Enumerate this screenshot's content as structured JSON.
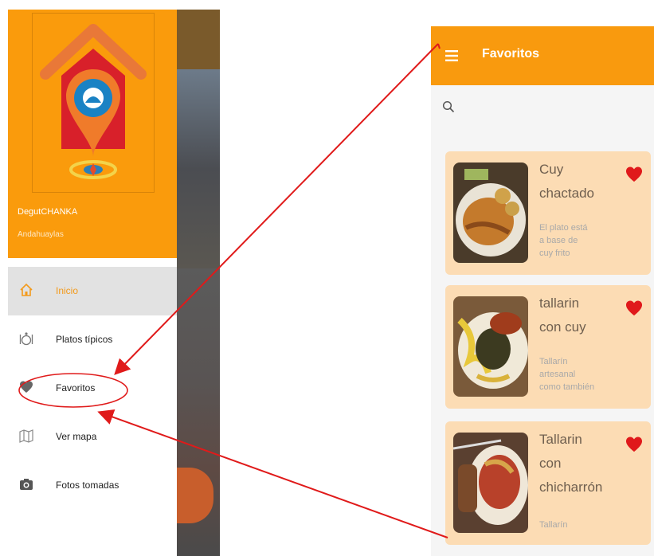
{
  "drawer": {
    "app_name": "DegutCHANKA",
    "app_subtitle": "Andahuaylas",
    "items": [
      {
        "label": "Inicio",
        "icon": "home-icon",
        "active": true
      },
      {
        "label": "Platos típicos",
        "icon": "dish-icon",
        "active": false
      },
      {
        "label": "Favoritos",
        "icon": "heart-icon",
        "active": false
      },
      {
        "label": "Ver mapa",
        "icon": "map-icon",
        "active": false
      },
      {
        "label": "Fotos tomadas",
        "icon": "camera-icon",
        "active": false
      }
    ]
  },
  "favorites": {
    "title": "Favoritos",
    "items": [
      {
        "name_lines": [
          "Cuy",
          "chactado"
        ],
        "desc_lines": [
          "El plato está",
          "a base de",
          "cuy frito"
        ]
      },
      {
        "name_lines": [
          "tallarin",
          "con cuy"
        ],
        "desc_lines": [
          "Tallarín",
          "artesanal",
          "como también"
        ]
      },
      {
        "name_lines": [
          "Tallarin",
          "con",
          "chicharrón"
        ],
        "desc_lines": [
          "Tallarín"
        ]
      }
    ]
  },
  "colors": {
    "accent": "#f99a0e",
    "card": "#fcdcb4",
    "heart": "#e0191b",
    "annotation": "#e01a1a"
  }
}
